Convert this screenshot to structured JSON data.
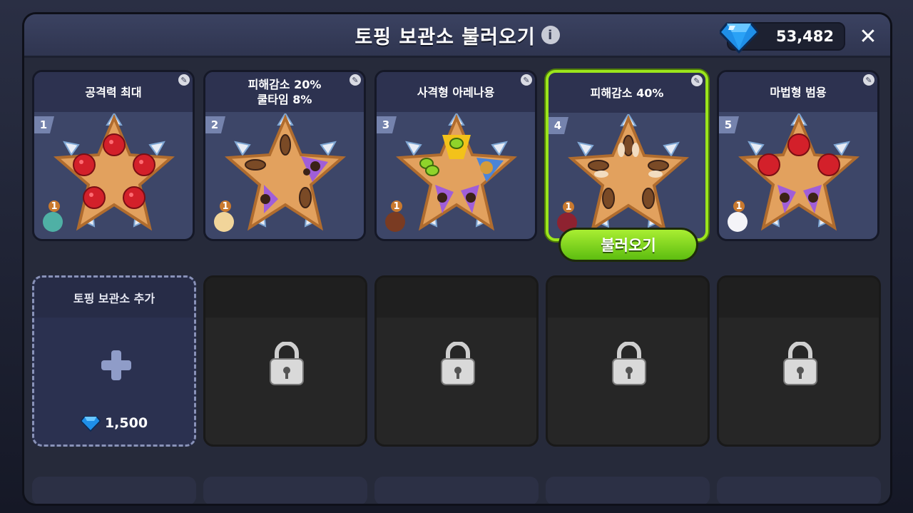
{
  "dialog": {
    "title": "토핑 보관소 불러오기",
    "info_icon": "i",
    "close_label": "✕",
    "currency": {
      "icon": "crystal-icon",
      "value": "53,482"
    }
  },
  "presets": [
    {
      "number": "1",
      "name": "공격력 최대",
      "cookie_level": "1"
    },
    {
      "number": "2",
      "name": "피해감소 20%\n쿨타임 8%",
      "cookie_level": "1"
    },
    {
      "number": "3",
      "name": "사격형 아레나용",
      "cookie_level": "1"
    },
    {
      "number": "4",
      "name": "피해감소 40%",
      "cookie_level": "1"
    },
    {
      "number": "5",
      "name": "마법형 범용",
      "cookie_level": "1"
    }
  ],
  "load_button": "불러오기",
  "add_slot": {
    "title": "토핑 보관소 추가",
    "cost": "1,500",
    "icon": "plus-icon"
  },
  "colors": {
    "selected_border": "#9be51c",
    "load_button": "#7bd41e",
    "raspberry": "#d3202a",
    "chocolate": "#3b2217",
    "almond": "#c08a55",
    "apple_jelly": "#8fd42a"
  }
}
